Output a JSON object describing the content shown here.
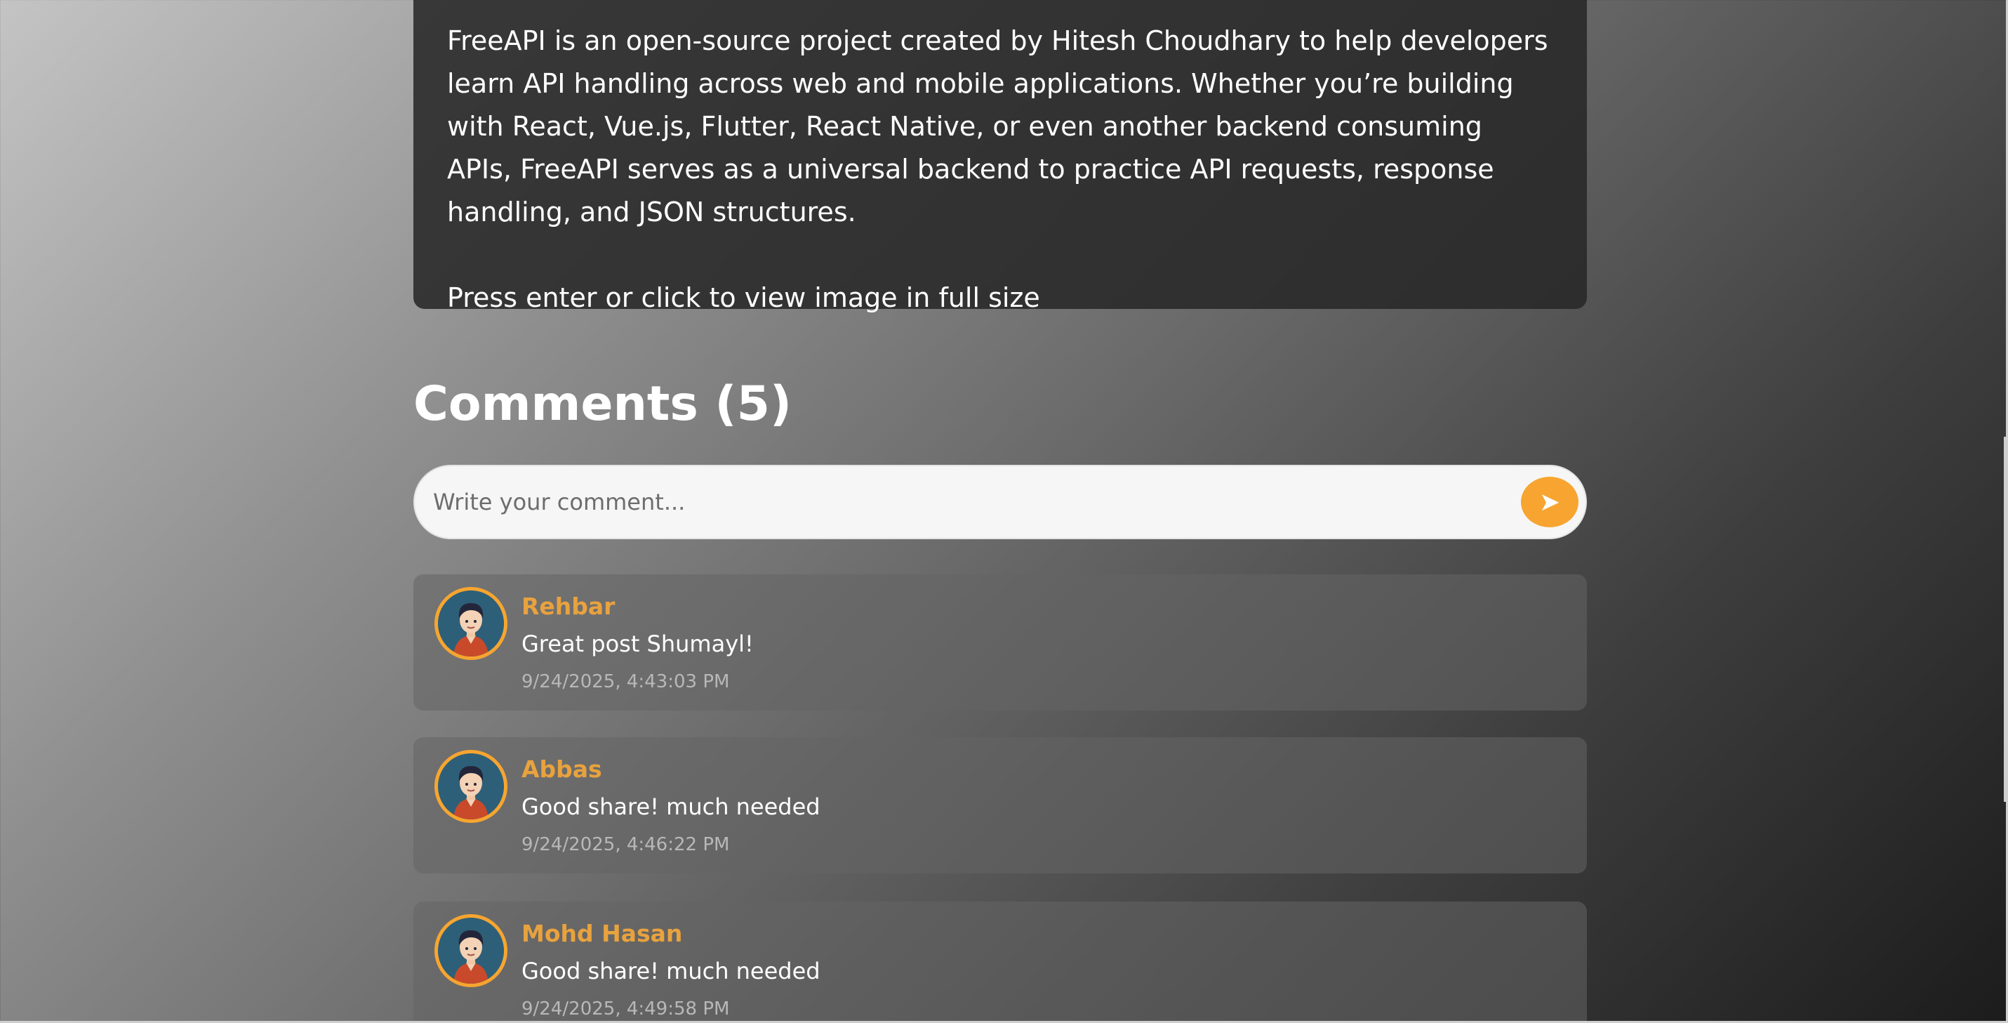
{
  "post": {
    "description": "FreeAPI is an open-source project created by Hitesh Choudhary to help developers learn API handling across web and mobile applications. Whether you’re building with React, Vue.js, Flutter, React Native, or even another backend consuming APIs, FreeAPI serves as a universal backend to practice API requests, response handling, and JSON structures.",
    "image_hint": "Press enter or click to view image in full size"
  },
  "comments_section": {
    "title": "Comments (5)",
    "input_placeholder": "Write your comment...",
    "send_icon": "➤",
    "items": [
      {
        "author": "Rehbar",
        "text": "Great post Shumayl!",
        "timestamp": "9/24/2025, 4:43:03 PM"
      },
      {
        "author": "Abbas",
        "text": "Good share! much needed",
        "timestamp": "9/24/2025, 4:46:22 PM"
      },
      {
        "author": "Mohd Hasan",
        "text": "Good share! much needed",
        "timestamp": "9/24/2025, 4:49:58 PM"
      }
    ]
  },
  "colors": {
    "accent": "#f7a530",
    "author_name": "#e8a23e",
    "card_dark": "#2b2b2b"
  }
}
